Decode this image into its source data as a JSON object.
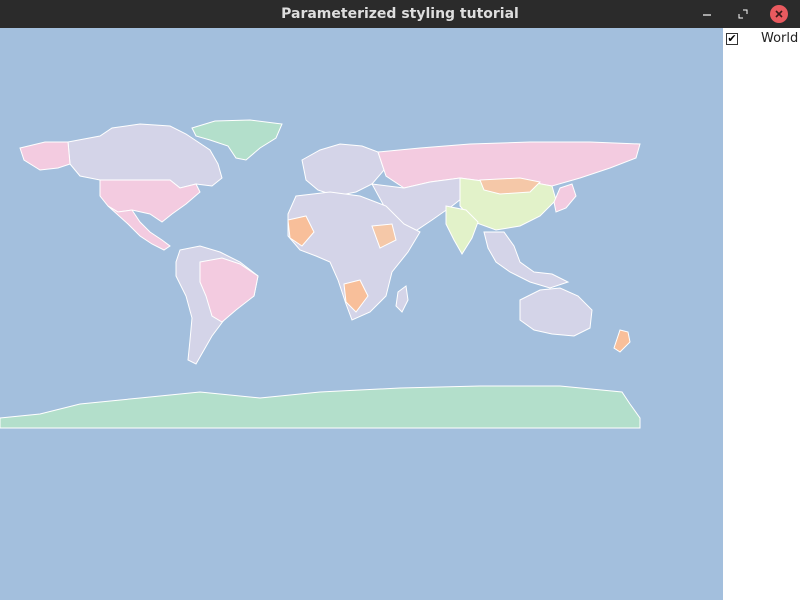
{
  "window": {
    "title": "Parameterized styling tutorial",
    "minimize_icon": "minimize-icon",
    "maximize_icon": "maximize-icon",
    "close_icon": "close-icon"
  },
  "map": {
    "background_color": "#a3bfdd",
    "land_colors": [
      "#f3cbe0",
      "#d4d4e8",
      "#f5c8a8",
      "#e2f2c9",
      "#b3dfcb",
      "#f8bf9a"
    ]
  },
  "layers": {
    "items": [
      {
        "label": "World",
        "checked": true,
        "check_glyph": "✔"
      }
    ]
  }
}
